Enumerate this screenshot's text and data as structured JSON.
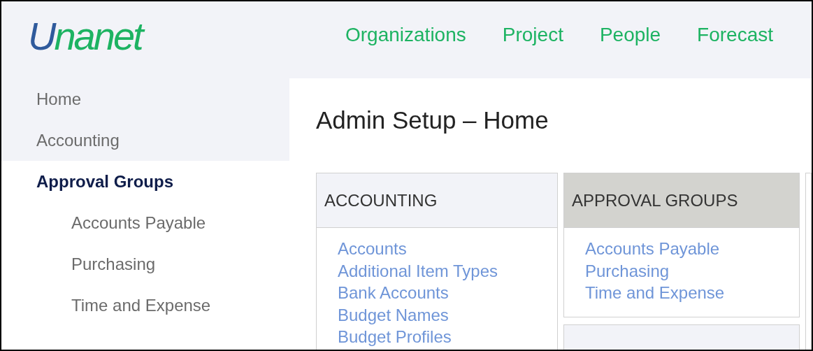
{
  "logo": "Unanet",
  "nav": [
    "Organizations",
    "Project",
    "People",
    "Forecast"
  ],
  "sidebar": {
    "items": [
      {
        "label": "Home",
        "selected": false
      },
      {
        "label": "Accounting",
        "selected": false
      },
      {
        "label": "Approval Groups",
        "selected": true,
        "children": [
          {
            "label": "Accounts Payable",
            "selected": false
          },
          {
            "label": "Purchasing",
            "selected": false
          },
          {
            "label": "Time and Expense",
            "selected": false
          }
        ]
      }
    ]
  },
  "page_title": "Admin Setup – Home",
  "cards": [
    {
      "title": "ACCOUNTING",
      "highlighted": false,
      "links": [
        "Accounts",
        "Additional Item Types",
        "Bank Accounts",
        "Budget Names",
        "Budget Profiles"
      ]
    },
    {
      "title": "APPROVAL GROUPS",
      "highlighted": true,
      "links": [
        "Accounts Payable",
        "Purchasing",
        "Time and Expense"
      ]
    }
  ]
}
